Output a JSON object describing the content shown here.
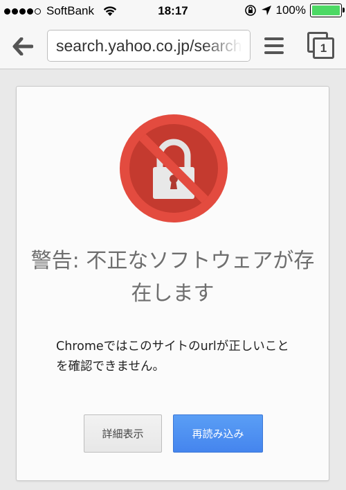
{
  "status_bar": {
    "signal_dots_filled": 4,
    "signal_dots_total": 5,
    "carrier": "SoftBank",
    "time": "18:17",
    "battery_percent": "100%",
    "battery_level": 1.0,
    "battery_color": "#4cd964"
  },
  "toolbar": {
    "back_icon": "back-arrow-icon",
    "url": "search.yahoo.co.jp/search",
    "menu_icon": "hamburger-menu-icon",
    "tab_count": "1"
  },
  "interstitial": {
    "icon": "blocked-lock-icon",
    "icon_color": "#e34b3f",
    "title": "警告: 不正なソフトウェアが存在します",
    "message": "Chromeではこのサイトのurlが正しいことを確認できません。",
    "details_button": "詳細表示",
    "reload_button": "再読み込み",
    "reload_color": "#4a8af0"
  }
}
